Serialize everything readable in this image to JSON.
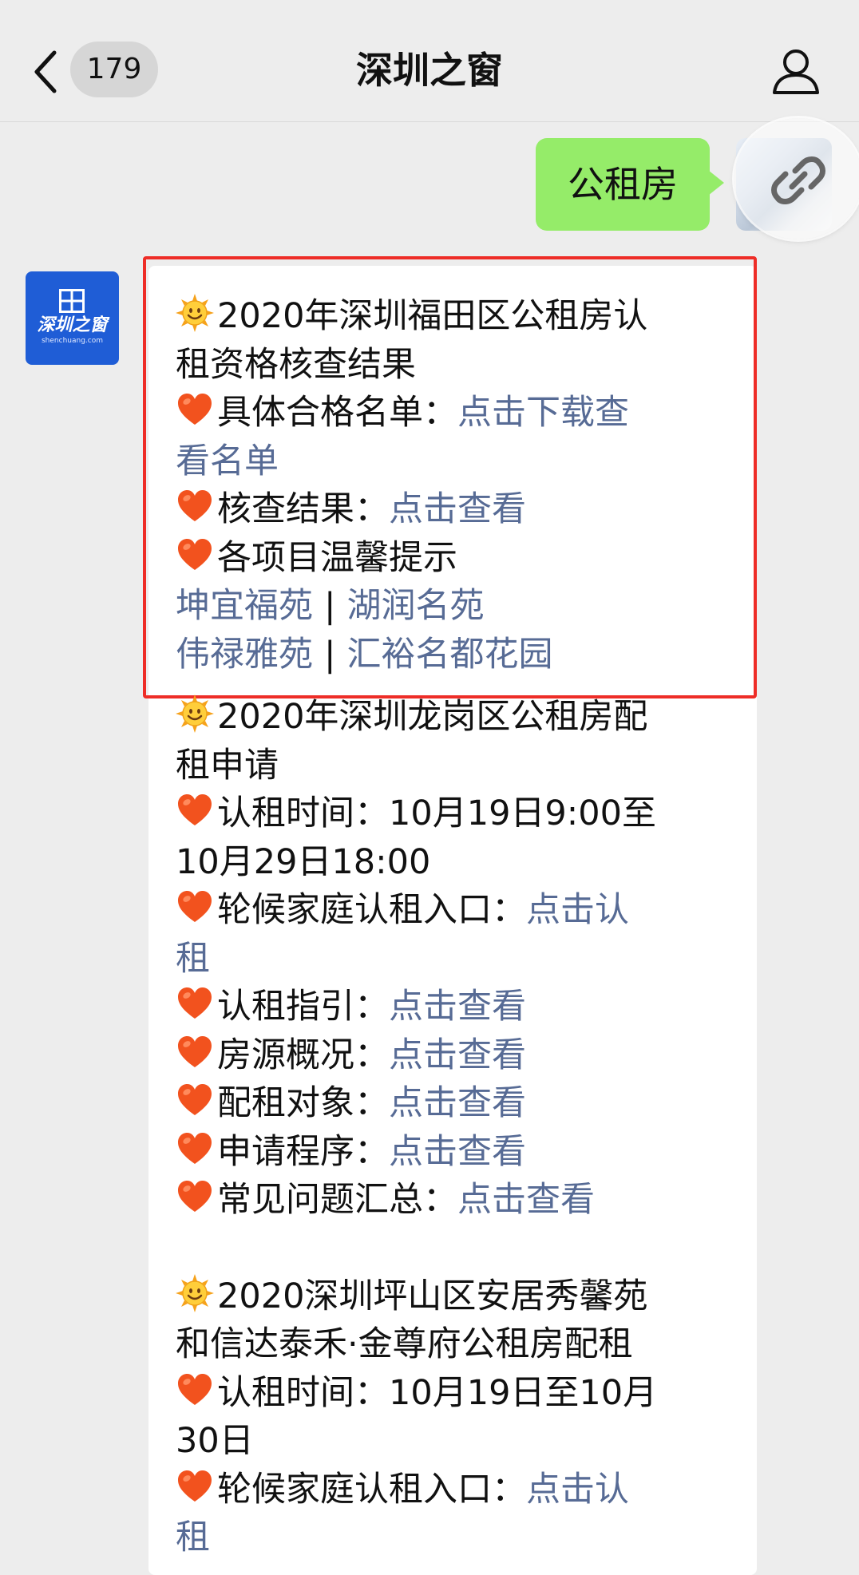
{
  "header": {
    "unread_count": "179",
    "title": "深圳之窗"
  },
  "outgoing": {
    "text": "公租房"
  },
  "sender": {
    "logo_text": "深圳之窗",
    "logo_sub": "shenchuang.com"
  },
  "colors": {
    "link": "#576b95",
    "outgoing_bubble": "#95ec69",
    "highlight_border": "#ee2d27",
    "logo_blue": "#1f5dd6"
  },
  "message": {
    "sec1": {
      "title_a": "2020年深圳福田区公租房认",
      "title_b": "租资格核查结果",
      "item1_label": "具体合格名单：",
      "item1_link_a": "点击下载查",
      "item1_link_b": "看名单",
      "item2_label": "核查结果：",
      "item2_link": "点击查看",
      "item3_label": "各项目温馨提示",
      "proj1": "坤宜福苑",
      "proj2": "湖润名苑",
      "proj3": "伟禄雅苑",
      "proj4": "汇裕名都花园",
      "divider": "|"
    },
    "sec2": {
      "title_a": "2020年深圳龙岗区公租房配",
      "title_b": "租申请",
      "time_a": "认租时间：10月19日9:00至",
      "time_b": "10月29日18:00",
      "entry_label": "轮候家庭认租入口：",
      "entry_link_a": "点击认",
      "entry_link_b": "租",
      "guide_label": "认租指引：",
      "house_label": "房源概况：",
      "target_label": "配租对象：",
      "process_label": "申请程序：",
      "faq_label": "常见问题汇总：",
      "view_link": "点击查看"
    },
    "sec3": {
      "title_a": "2020深圳坪山区安居秀馨苑",
      "title_b": "和信达泰禾·金尊府公租房配租",
      "time_a": "认租时间：10月19日至10月",
      "time_b": "30日",
      "entry_label": "轮候家庭认租入口：",
      "entry_link_a": "点击认",
      "entry_link_b": "租"
    }
  },
  "icons": [
    "back-arrow-icon",
    "profile-icon",
    "link-icon",
    "sun-emoji-icon",
    "heart-emoji-icon",
    "window-logo-icon"
  ]
}
